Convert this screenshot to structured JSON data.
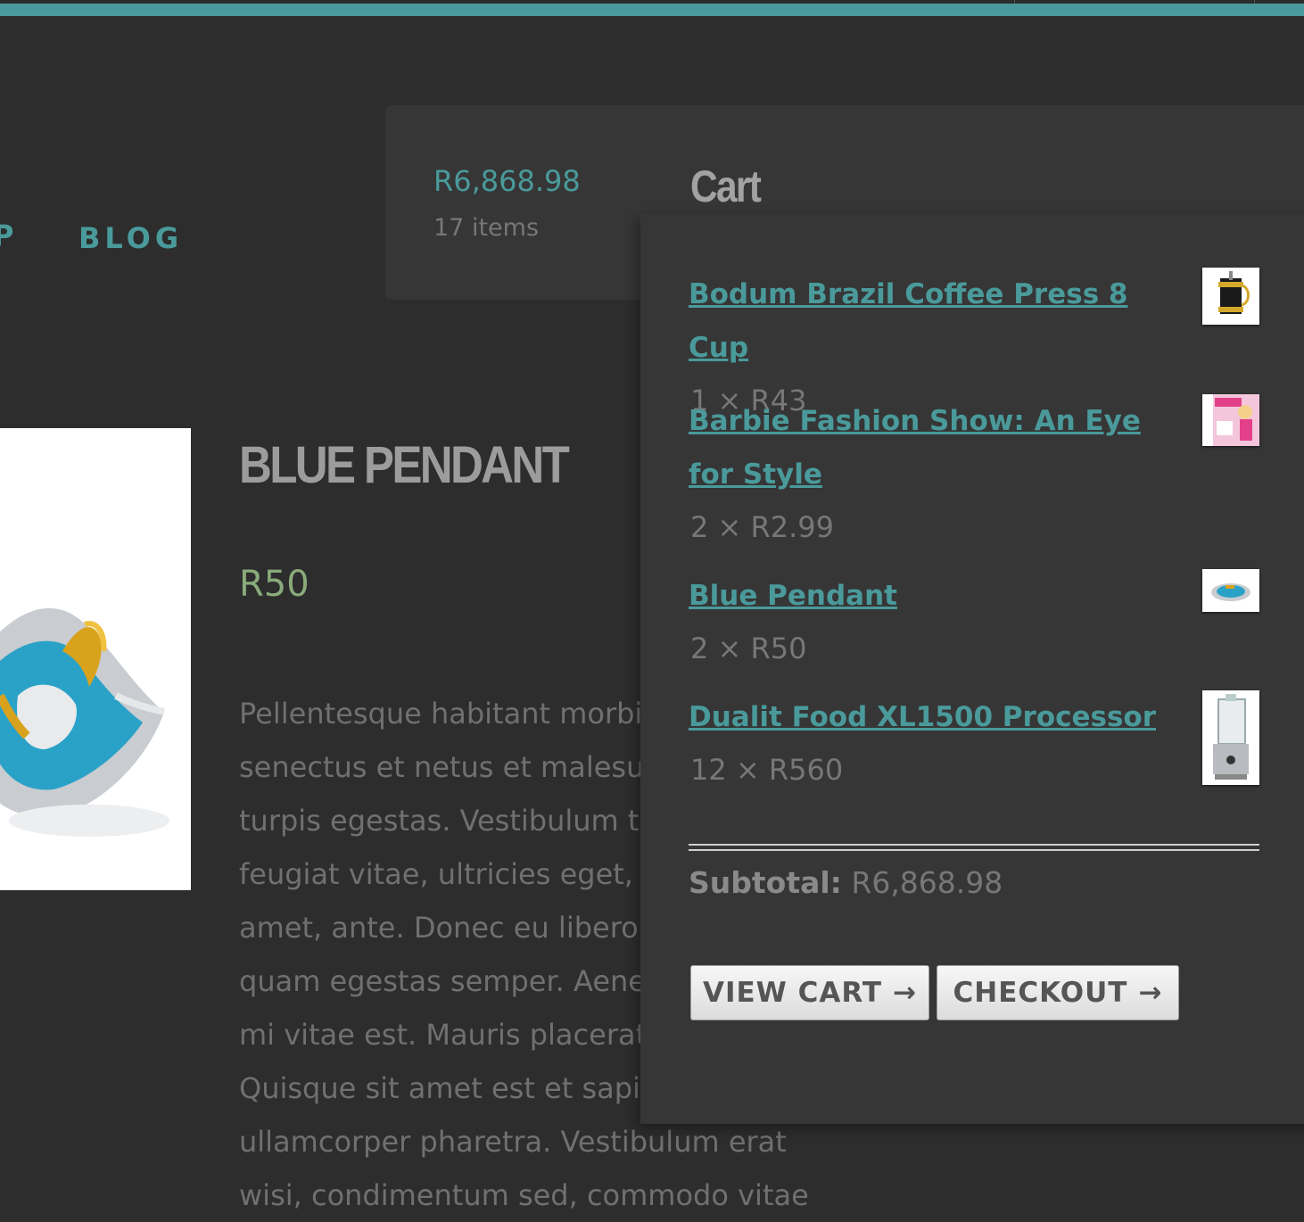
{
  "nav": {
    "partial_item": "P",
    "blog_label": "BLOG"
  },
  "product": {
    "title": "BLUE PENDANT",
    "price": "R50",
    "description_lines": [
      "Pellentesque habitant morbi",
      "senectus et netus et malesua",
      "turpis egestas. Vestibulum to",
      "feugiat vitae, ultricies eget, te",
      "amet, ante. Donec eu libero s",
      "quam egestas semper. Aene",
      "mi vitae est. Mauris placerat e",
      "Quisque sit amet est et sapie",
      "ullamcorper pharetra. Vestibulum erat",
      "wisi, condimentum sed, commodo vitae"
    ]
  },
  "cart_summary": {
    "total": "R6,868.98",
    "count": "17 items"
  },
  "cart": {
    "title": "Cart",
    "items": [
      {
        "name": "Bodum Brazil Coffee Press 8 Cup",
        "qty": "1 × R43",
        "thumb_icon": "coffee-press-icon"
      },
      {
        "name": "Barbie Fashion Show: An Eye for Style",
        "qty": "2 × R2.99",
        "thumb_icon": "barbie-game-icon"
      },
      {
        "name": "Blue Pendant",
        "qty": "2 × R50",
        "thumb_icon": "pendant-icon"
      },
      {
        "name": "Dualit Food XL1500 Processor",
        "qty": "12 × R560",
        "thumb_icon": "food-processor-icon"
      }
    ],
    "subtotal_label": "Subtotal:",
    "subtotal_value": "R6,868.98",
    "view_cart_label": "VIEW CART",
    "checkout_label": "CHECKOUT",
    "arrow": "→"
  },
  "colors": {
    "accent": "#4a9a9b",
    "background": "#2d2d2d",
    "panel": "#363636",
    "price_green": "#8aab7a"
  }
}
